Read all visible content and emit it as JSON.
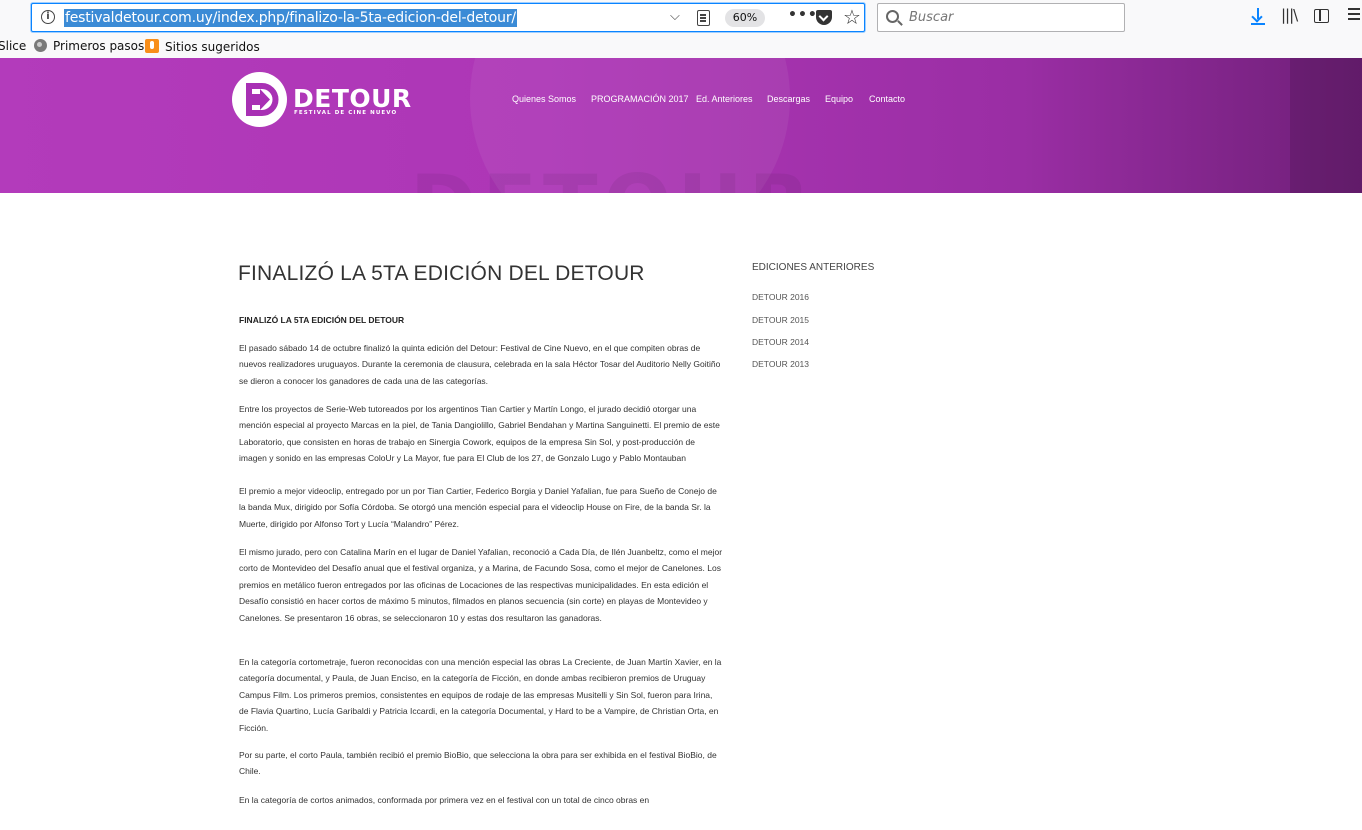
{
  "browser": {
    "url": "festivaldetour.com.uy/index.php/finalizo-la-5ta-edicion-del-detour/",
    "zoom": "60%",
    "search_placeholder": "Buscar",
    "bookmarks": [
      "Slice",
      "Primeros pasos",
      "Sitios sugeridos"
    ]
  },
  "site": {
    "logo_text": "DETOUR",
    "logo_subtitle": "FESTIVAL DE CINE NUEVO",
    "nav": [
      "Quienes Somos",
      "PROGRAMACIÓN 2017",
      "Ed. Anteriores",
      "Descargas",
      "Equipo",
      "Contacto"
    ],
    "accent_color": "#b33bbb"
  },
  "article": {
    "title": "FINALIZÓ LA 5TA EDICIÓN DEL DETOUR",
    "subtitle": "FINALIZÓ LA 5TA EDICIÓN DEL DETOUR",
    "paragraphs": [
      "El pasado sábado 14 de octubre finalizó la quinta edición del Detour: Festival de Cine Nuevo, en el que compiten obras de nuevos realizadores uruguayos. Durante la ceremonia de clausura, celebrada en la sala Héctor Tosar del Auditorio Nelly Goitiño se dieron a conocer los ganadores de cada una de las categorías.",
      "Entre los proyectos de Serie-Web tutoreados por los argentinos Tian Cartier y Martín Longo, el jurado decidió otorgar una mención especial al proyecto Marcas en la piel, de Tania Dangiolillo, Gabriel Bendahan y Martina Sanguinetti. El premio de este Laboratorio, que consisten en horas de trabajo en Sinergia Cowork, equipos de la empresa Sin Sol, y post-producción de imagen y sonido en las empresas ColoUr y La Mayor, fue para El Club de los 27, de Gonzalo Lugo y Pablo Montauban",
      "El premio a mejor videoclip, entregado por un por Tian Cartier, Federico Borgia y Daniel Yafalian, fue para Sueño de Conejo de la banda Mux, dirigido por Sofía Córdoba. Se otorgó una mención especial para el videoclip House on Fire, de la banda Sr. la Muerte, dirigido por Alfonso Tort y Lucía “Malandro” Pérez.",
      "El mismo jurado, pero con Catalina Marín en el lugar de Daniel Yafalian, reconoció a Cada Día, de Ilén Juanbeltz, como el mejor corto de Montevideo del Desafío anual que el festival organiza, y a Marina, de Facundo Sosa, como el mejor de Canelones. Los premios en metálico fueron entregados por las oficinas de Locaciones de las respectivas municipalidades. En esta edición el Desafío consistió en hacer cortos de máximo 5 minutos, filmados en planos secuencia (sin corte) en playas de Montevideo y Canelones. Se presentaron 16 obras, se seleccionaron 10 y estas dos resultaron las ganadoras.",
      "En la categoría cortometraje, fueron reconocidas con una mención especial las obras La Creciente, de Juan Martín Xavier, en la categoría documental, y Paula, de Juan Enciso, en la categoría de Ficción, en donde ambas recibieron premios de Uruguay Campus Film. Los primeros premios, consistentes en equipos de rodaje de las empresas Musitelli y Sin Sol, fueron para Irina, de Flavia Quartino, Lucía Garibaldi y Patricia Iccardi, en la categoría Documental, y Hard to be a Vampire, de Christian Orta, en Ficción.",
      "Por su parte, el corto Paula, también recibió el premio BioBio, que selecciona la obra para ser exhibida en el festival BioBio, de Chile.",
      "En la categoría de cortos animados, conformada por primera vez en el festival con un total de cinco obras en"
    ]
  },
  "sidebar": {
    "title": "EDICIONES ANTERIORES",
    "links": [
      "DETOUR 2016",
      "DETOUR 2015",
      "DETOUR 2014",
      "DETOUR 2013"
    ]
  }
}
